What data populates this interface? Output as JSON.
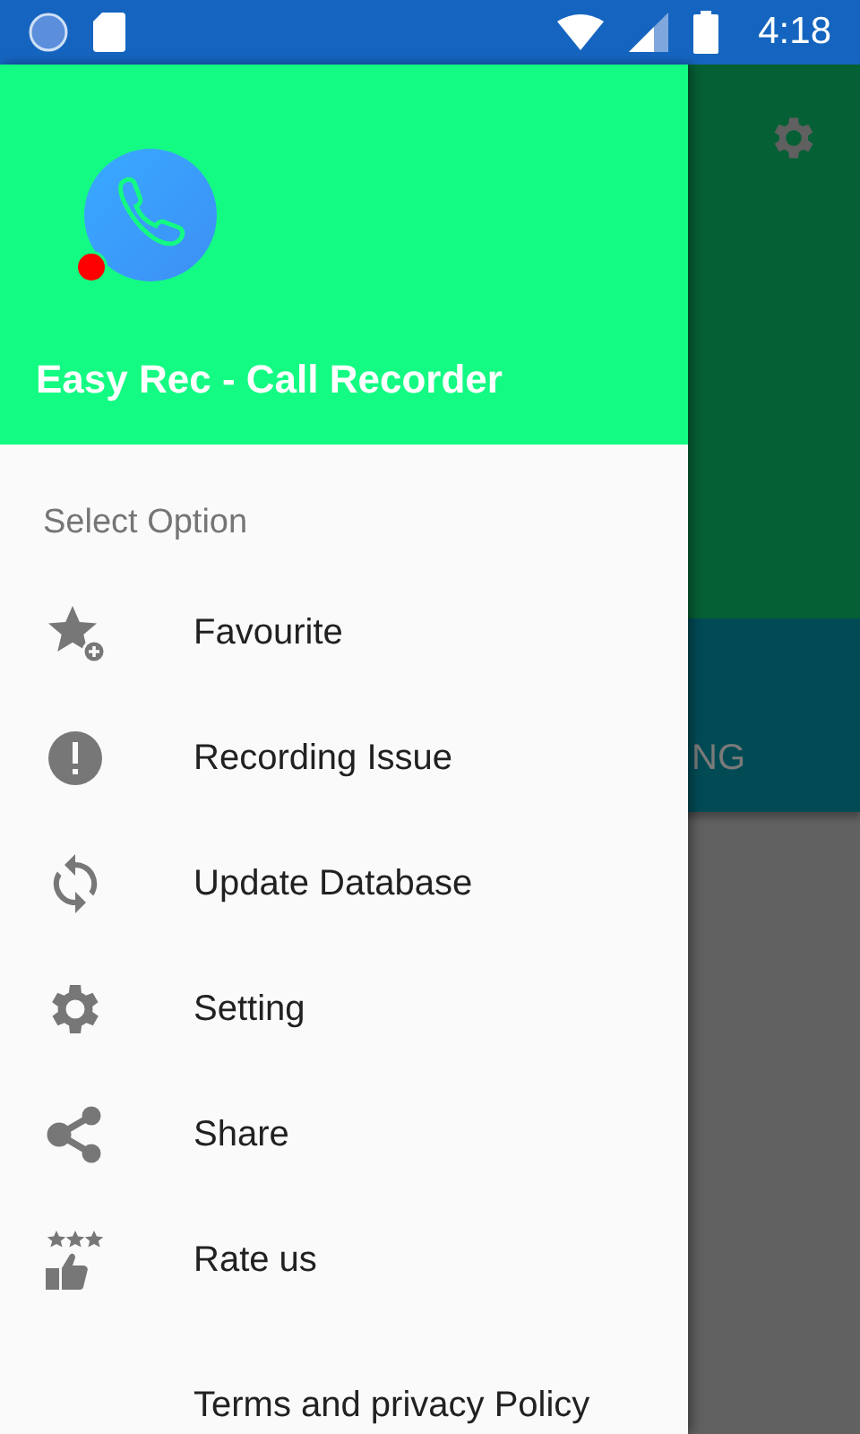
{
  "status_bar": {
    "time": "4:18"
  },
  "background_app": {
    "tab_label": "NG"
  },
  "drawer": {
    "header": {
      "title": "Easy Rec - Call Recorder"
    },
    "section_title": "Select Option",
    "items": [
      {
        "kind": "star",
        "label": "Favourite"
      },
      {
        "kind": "alert",
        "label": "Recording Issue"
      },
      {
        "kind": "sync",
        "label": "Update Database"
      },
      {
        "kind": "gear",
        "label": "Setting"
      },
      {
        "kind": "share",
        "label": "Share"
      },
      {
        "kind": "rate",
        "label": "Rate us"
      },
      {
        "kind": "plain",
        "label": "Terms and privacy Policy"
      }
    ]
  }
}
